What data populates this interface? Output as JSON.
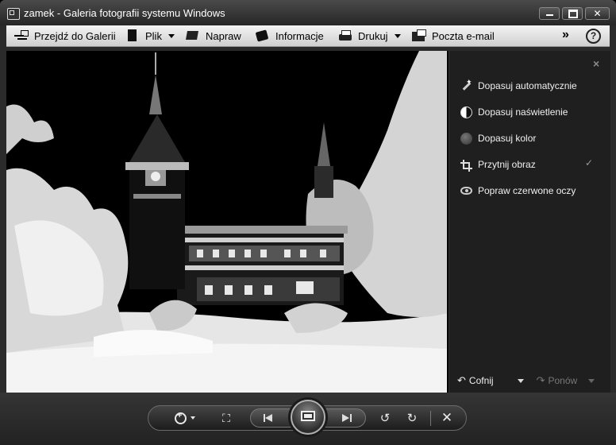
{
  "window": {
    "title": "zamek - Galeria fotografii systemu Windows"
  },
  "menubar": {
    "items": [
      {
        "label": "Przejdź do Galerii",
        "icon": "gallery-icon",
        "dropdown": false
      },
      {
        "label": "Plik",
        "icon": "file-icon",
        "dropdown": true
      },
      {
        "label": "Napraw",
        "icon": "fix-icon",
        "dropdown": false
      },
      {
        "label": "Informacje",
        "icon": "info-icon",
        "dropdown": false
      },
      {
        "label": "Drukuj",
        "icon": "print-icon",
        "dropdown": true
      },
      {
        "label": "Poczta e-mail",
        "icon": "email-icon",
        "dropdown": false
      }
    ],
    "more": "»",
    "help": "?"
  },
  "fix_panel": {
    "close": "×",
    "items": [
      {
        "label": "Dopasuj automatycznie",
        "icon": "magic-wand-icon"
      },
      {
        "label": "Dopasuj naświetlenie",
        "icon": "exposure-icon"
      },
      {
        "label": "Dopasuj kolor",
        "icon": "color-icon"
      },
      {
        "label": "Przytnij obraz",
        "icon": "crop-icon",
        "checked": true
      },
      {
        "label": "Popraw czerwone oczy",
        "icon": "red-eye-icon"
      }
    ],
    "check": "✓",
    "undo_label": "Cofnij",
    "redo_label": "Ponów"
  },
  "controls": {
    "fit": "⛶",
    "rotate_left": "↺",
    "rotate_right": "↻",
    "delete": "✕"
  },
  "colors": {
    "titlebar": "#262626",
    "menubar": "#e6e6e6",
    "panel": "#1f1f1f",
    "photo_background": "#000000"
  }
}
